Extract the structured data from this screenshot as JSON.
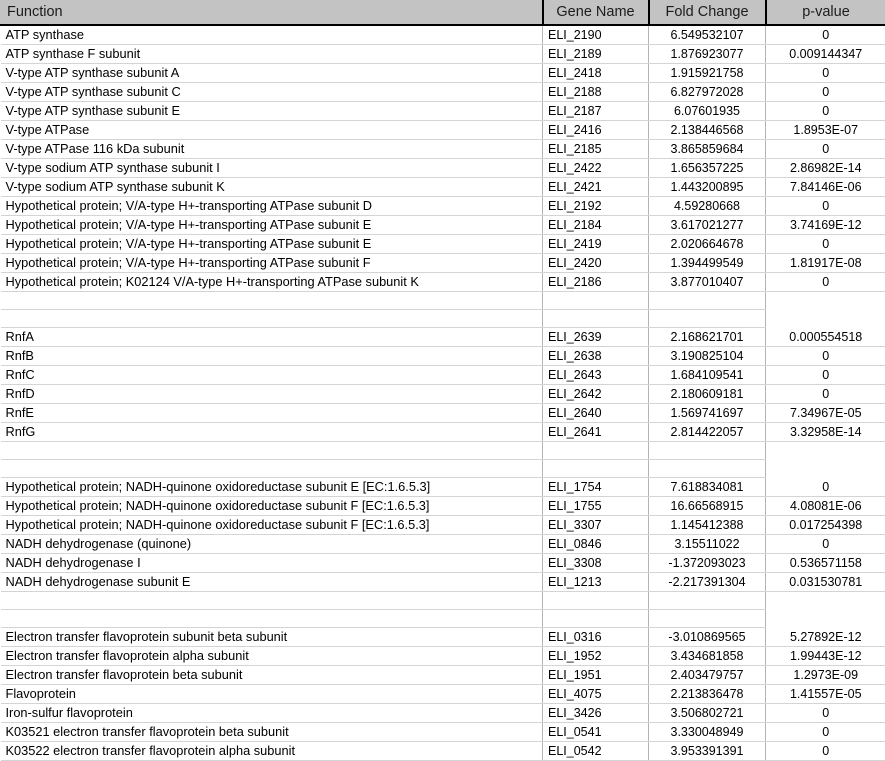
{
  "table": {
    "columns": [
      {
        "key": "function",
        "label": "Function",
        "align": "left"
      },
      {
        "key": "gene",
        "label": "Gene Name",
        "align": "center"
      },
      {
        "key": "fold",
        "label": "Fold Change",
        "align": "center"
      },
      {
        "key": "pval",
        "label": "p-value",
        "align": "center"
      }
    ],
    "header_bg": "#c3c3c3",
    "grid_color": "#d4d4d4",
    "rows": [
      {
        "type": "data",
        "function": "ATP synthase",
        "gene": "ELI_2190",
        "fold": "6.549532107",
        "pval": "0"
      },
      {
        "type": "data",
        "function": "ATP synthase F subunit",
        "gene": "ELI_2189",
        "fold": "1.876923077",
        "pval": "0.009144347"
      },
      {
        "type": "data",
        "function": "V-type ATP synthase subunit A",
        "gene": "ELI_2418",
        "fold": "1.915921758",
        "pval": "0"
      },
      {
        "type": "data",
        "function": "V-type ATP synthase subunit C",
        "gene": "ELI_2188",
        "fold": "6.827972028",
        "pval": "0"
      },
      {
        "type": "data",
        "function": "V-type ATP synthase subunit E",
        "gene": "ELI_2187",
        "fold": "6.07601935",
        "pval": "0"
      },
      {
        "type": "data",
        "function": "V-type ATPase",
        "gene": "ELI_2416",
        "fold": "2.138446568",
        "pval": "1.8953E-07"
      },
      {
        "type": "data",
        "function": "V-type ATPase 116 kDa subunit",
        "gene": "ELI_2185",
        "fold": "3.865859684",
        "pval": "0"
      },
      {
        "type": "data",
        "function": "V-type sodium ATP synthase subunit I",
        "gene": "ELI_2422",
        "fold": "1.656357225",
        "pval": "2.86982E-14"
      },
      {
        "type": "data",
        "function": "V-type sodium ATP synthase subunit K",
        "gene": "ELI_2421",
        "fold": "1.443200895",
        "pval": "7.84146E-06"
      },
      {
        "type": "data",
        "function": "Hypothetical protein; V/A-type H+-transporting ATPase subunit D",
        "gene": "ELI_2192",
        "fold": "4.59280668",
        "pval": "0"
      },
      {
        "type": "data",
        "function": "Hypothetical protein; V/A-type H+-transporting ATPase subunit E",
        "gene": "ELI_2184",
        "fold": "3.617021277",
        "pval": "3.74169E-12"
      },
      {
        "type": "data",
        "function": "Hypothetical protein; V/A-type H+-transporting ATPase subunit E",
        "gene": "ELI_2419",
        "fold": "2.020664678",
        "pval": "0"
      },
      {
        "type": "data",
        "function": "Hypothetical protein; V/A-type H+-transporting ATPase subunit F",
        "gene": "ELI_2420",
        "fold": "1.394499549",
        "pval": "1.81917E-08"
      },
      {
        "type": "data",
        "function": "Hypothetical protein; K02124 V/A-type H+-transporting ATPase subunit K",
        "gene": "ELI_2186",
        "fold": "3.877010407",
        "pval": "0"
      },
      {
        "type": "spacer",
        "function": "",
        "gene": "",
        "fold": "",
        "pval": ""
      },
      {
        "type": "spacer",
        "function": "",
        "gene": "",
        "fold": "",
        "pval": ""
      },
      {
        "type": "data",
        "function": "RnfA",
        "gene": "ELI_2639",
        "fold": "2.168621701",
        "pval": "0.000554518"
      },
      {
        "type": "data",
        "function": "RnfB",
        "gene": "ELI_2638",
        "fold": "3.190825104",
        "pval": "0"
      },
      {
        "type": "data",
        "function": "RnfC",
        "gene": "ELI_2643",
        "fold": "1.684109541",
        "pval": "0"
      },
      {
        "type": "data",
        "function": "RnfD",
        "gene": "ELI_2642",
        "fold": "2.180609181",
        "pval": "0"
      },
      {
        "type": "data",
        "function": "RnfE",
        "gene": "ELI_2640",
        "fold": "1.569741697",
        "pval": "7.34967E-05"
      },
      {
        "type": "data",
        "function": "RnfG",
        "gene": "ELI_2641",
        "fold": "2.814422057",
        "pval": "3.32958E-14"
      },
      {
        "type": "spacer",
        "function": "",
        "gene": "",
        "fold": "",
        "pval": ""
      },
      {
        "type": "spacer",
        "function": "",
        "gene": "",
        "fold": "",
        "pval": ""
      },
      {
        "type": "data",
        "function": "Hypothetical protein; NADH-quinone oxidoreductase subunit E [EC:1.6.5.3]",
        "gene": "ELI_1754",
        "fold": "7.618834081",
        "pval": "0"
      },
      {
        "type": "data",
        "function": "Hypothetical protein; NADH-quinone oxidoreductase subunit F [EC:1.6.5.3]",
        "gene": "ELI_1755",
        "fold": "16.66568915",
        "pval": "4.08081E-06"
      },
      {
        "type": "data",
        "function": "Hypothetical protein; NADH-quinone oxidoreductase subunit F [EC:1.6.5.3]",
        "gene": "ELI_3307",
        "fold": "1.145412388",
        "pval": "0.017254398"
      },
      {
        "type": "data",
        "function": "NADH dehydrogenase (quinone)",
        "gene": "ELI_0846",
        "fold": "3.15511022",
        "pval": "0"
      },
      {
        "type": "data",
        "function": "NADH dehydrogenase I",
        "gene": "ELI_3308",
        "fold": "-1.372093023",
        "pval": "0.536571158"
      },
      {
        "type": "data",
        "function": "NADH dehydrogenase subunit E",
        "gene": "ELI_1213",
        "fold": "-2.217391304",
        "pval": "0.031530781"
      },
      {
        "type": "spacer",
        "function": "",
        "gene": "",
        "fold": "",
        "pval": ""
      },
      {
        "type": "spacer",
        "function": "",
        "gene": "",
        "fold": "",
        "pval": ""
      },
      {
        "type": "data",
        "function": "Electron transfer flavoprotein subunit beta subunit",
        "gene": "ELI_0316",
        "fold": "-3.010869565",
        "pval": "5.27892E-12"
      },
      {
        "type": "data",
        "function": "Electron transfer flavoprotein alpha subunit",
        "gene": "ELI_1952",
        "fold": "3.434681858",
        "pval": "1.99443E-12"
      },
      {
        "type": "data",
        "function": "Electron transfer flavoprotein beta subunit",
        "gene": "ELI_1951",
        "fold": "2.403479757",
        "pval": "1.2973E-09"
      },
      {
        "type": "data",
        "function": "Flavoprotein",
        "gene": "ELI_4075",
        "fold": "2.213836478",
        "pval": "1.41557E-05"
      },
      {
        "type": "data",
        "function": "Iron-sulfur flavoprotein",
        "gene": "ELI_3426",
        "fold": "3.506802721",
        "pval": "0"
      },
      {
        "type": "data",
        "function": "K03521 electron transfer flavoprotein beta subunit",
        "gene": "ELI_0541",
        "fold": "3.330048949",
        "pval": "0"
      },
      {
        "type": "data",
        "function": "K03522 electron transfer flavoprotein alpha subunit",
        "gene": "ELI_0542",
        "fold": "3.953391391",
        "pval": "0"
      }
    ]
  }
}
